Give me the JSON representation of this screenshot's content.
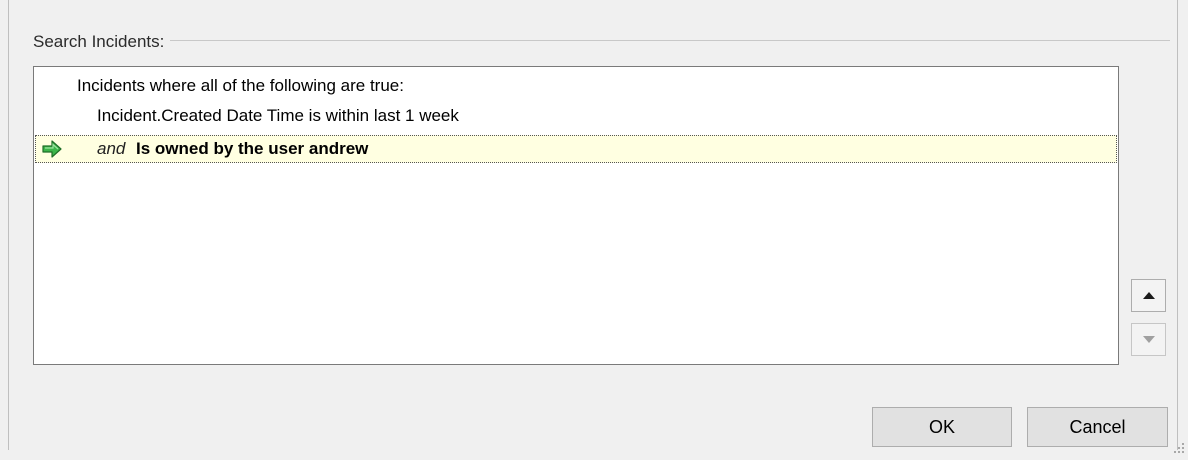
{
  "group": {
    "legend": "Search Incidents:"
  },
  "criteria": {
    "header": "Incidents where all of the following are true:",
    "condition1": "Incident.Created Date Time is within last 1 week",
    "condition2": {
      "conjunction": "and",
      "text": "Is owned by the user andrew",
      "icon": "green-right-arrow-icon"
    }
  },
  "buttons": {
    "ok": "OK",
    "cancel": "Cancel"
  },
  "colors": {
    "highlight_row": "#ffffe1",
    "arrow_green": "#3bb54a"
  }
}
